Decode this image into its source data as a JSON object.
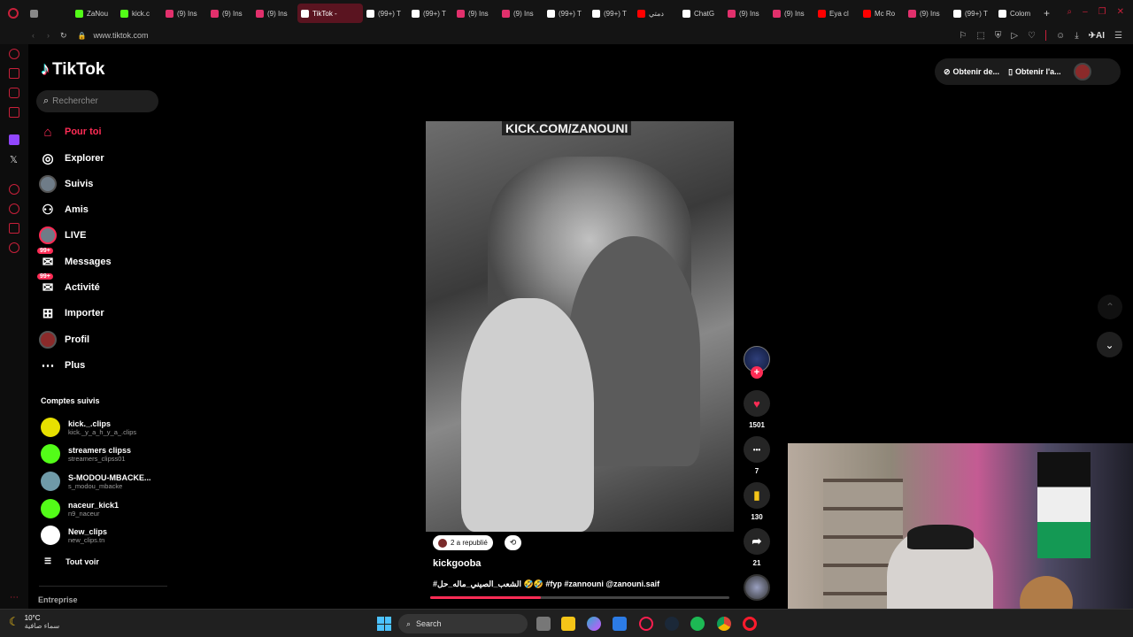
{
  "browser": {
    "tabs": [
      {
        "label": "",
        "color": "#888"
      },
      {
        "label": "ZaNou",
        "color": "#53fc18"
      },
      {
        "label": "kick.c",
        "color": "#53fc18"
      },
      {
        "label": "(9) Ins",
        "color": "#e1306c"
      },
      {
        "label": "(9) Ins",
        "color": "#e1306c"
      },
      {
        "label": "(9) Ins",
        "color": "#e1306c"
      },
      {
        "label": "TikTok - ",
        "color": "#ffffff",
        "active": true
      },
      {
        "label": "(99+) T",
        "color": "#ffffff"
      },
      {
        "label": "(99+) T",
        "color": "#ffffff"
      },
      {
        "label": "(9) Ins",
        "color": "#e1306c"
      },
      {
        "label": "(9) Ins",
        "color": "#e1306c"
      },
      {
        "label": "(99+) T",
        "color": "#ffffff"
      },
      {
        "label": "(99+) T",
        "color": "#ffffff"
      },
      {
        "label": "دمتي",
        "color": "#ff0000"
      },
      {
        "label": "ChatG",
        "color": "#ffffff"
      },
      {
        "label": "(9) Ins",
        "color": "#e1306c"
      },
      {
        "label": "(9) Ins",
        "color": "#e1306c"
      },
      {
        "label": "Eya cl",
        "color": "#ff0000"
      },
      {
        "label": "Mc Ro",
        "color": "#ff0000"
      },
      {
        "label": "(9) Ins",
        "color": "#e1306c"
      },
      {
        "label": "(99+) T",
        "color": "#ffffff"
      },
      {
        "label": "Colom",
        "color": "#ffffff"
      }
    ],
    "url": "www.tiktok.com",
    "ai_label": "AI"
  },
  "tiktok": {
    "logo": "TikTok",
    "search_placeholder": "Rechercher",
    "nav": [
      {
        "label": "Pour toi",
        "icon": "home-icon",
        "active": true
      },
      {
        "label": "Explorer",
        "icon": "compass-icon"
      },
      {
        "label": "Suivis",
        "icon": "following-avatar-icon"
      },
      {
        "label": "Amis",
        "icon": "friends-icon"
      },
      {
        "label": "LIVE",
        "icon": "live-avatar-icon"
      },
      {
        "label": "Messages",
        "icon": "messages-icon",
        "badge": "99+"
      },
      {
        "label": "Activité",
        "icon": "activity-icon",
        "badge": "99+"
      },
      {
        "label": "Importer",
        "icon": "upload-icon"
      },
      {
        "label": "Profil",
        "icon": "profile-avatar-icon"
      },
      {
        "label": "Plus",
        "icon": "more-icon"
      }
    ],
    "followed_title": "Comptes suivis",
    "followed": [
      {
        "name": "kick._.clips",
        "handle": "kick._y_a_h_y_a_.clips",
        "color": "#e7e000"
      },
      {
        "name": "streamers clipss",
        "handle": "streamers_clipss01",
        "color": "#53fc18"
      },
      {
        "name": "S-MODOU-MBACKE...",
        "handle": "s_modou_mbacke",
        "color": "#6f9aa8"
      },
      {
        "name": "naceur_kick1",
        "handle": "n9_naceur",
        "color": "#53fc18"
      },
      {
        "name": "New_clips",
        "handle": "new_clips.tn",
        "color": "#ffffff"
      }
    ],
    "see_all": "Tout voir",
    "enterprise": "Entreprise",
    "top_buttons": [
      "Obtenir de...",
      "Obtenir l'a..."
    ],
    "video": {
      "overlay_text": "KICK.COM/ZANOUNI",
      "reposted": "2 a republié",
      "author": "kickgooba",
      "caption": "#الشعب_الصيني_ماله_حل 🤣🤣 #fyp #zannouni @zanouni.saif"
    },
    "actions": [
      {
        "icon": "heart-icon",
        "count": "1501"
      },
      {
        "icon": "comment-icon",
        "count": "7"
      },
      {
        "icon": "bookmark-icon",
        "count": "130"
      },
      {
        "icon": "share-icon",
        "count": "21"
      }
    ]
  },
  "taskbar": {
    "weather_temp": "10°C",
    "weather_desc": "سماء صافية",
    "search_label": "Search"
  }
}
